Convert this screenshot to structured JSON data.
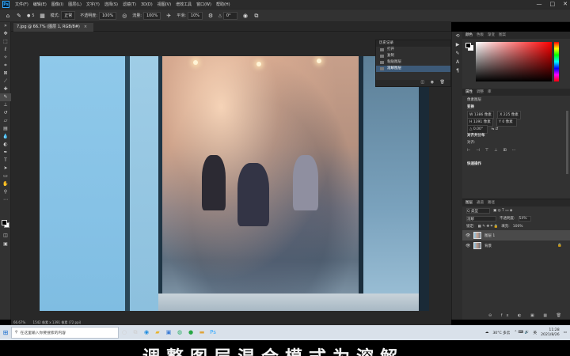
{
  "app": {
    "menu": [
      "文件(F)",
      "编辑(E)",
      "图像(I)",
      "图层(L)",
      "文字(Y)",
      "选择(S)",
      "滤镜(T)",
      "3D(D)",
      "视图(V)",
      "增效工具",
      "窗口(W)",
      "帮助(H)"
    ],
    "window_controls": [
      "—",
      "□",
      "✕"
    ]
  },
  "options": {
    "brush_size": "5",
    "mode_label": "模式:",
    "mode_value": "正常",
    "opacity_label": "不透明度:",
    "opacity_value": "100%",
    "flow_label": "流量:",
    "flow_value": "100%",
    "smooth_label": "平滑:",
    "smooth_value": "10%",
    "angle_value": "0°"
  },
  "document": {
    "tab_title": "7.jpg @ 66.7% (图层 1, RGB/8#)",
    "close_icon": "×"
  },
  "history": {
    "title": "历史记录",
    "items": [
      "打开",
      "复制",
      "粘贴图层",
      "溶解图层"
    ],
    "selected_index": 3,
    "footer_icons": "◫ ◉ 🗑"
  },
  "panels": {
    "color_tabs": [
      "颜色",
      "色板",
      "渐变",
      "图案"
    ],
    "props_tabs": [
      "属性",
      "调整",
      "库"
    ],
    "pixel_layer": "像素图层",
    "transform_title": "变换",
    "w": "W 1386 像素",
    "h": "H 1391 像素",
    "x": "X 225 像素",
    "y": "Y 0 像素",
    "angle": "△ 0.00°",
    "align_title": "对齐并分布",
    "align_label": "对齐:",
    "quick_actions": "快速操作"
  },
  "layers": {
    "tabs": [
      "图层",
      "通道",
      "路径"
    ],
    "kind": "Q 类型",
    "blend_mode": "溶解",
    "opacity_label": "不透明度:",
    "opacity_value": "54%",
    "lock_label": "锁定:",
    "fill_label": "填充:",
    "fill_value": "100%",
    "items": [
      {
        "name": "图层 1",
        "selected": true
      },
      {
        "name": "背景",
        "selected": false
      }
    ],
    "footer_icons": "⊖ fx ◐ ▣ ▦ 🗑"
  },
  "status": {
    "zoom": "66.67%",
    "size": "1542 像素 x 1391 像素 (72 ppi)"
  },
  "taskbar": {
    "search_placeholder": "在这里输入你要搜索的内容",
    "weather": "30°C 多云",
    "lang": "英",
    "time": "11:28",
    "date": "2021/8/26"
  },
  "subtitle": "调整图层混合模式为溶解",
  "colors": {
    "ps_blue": "#31a8ff",
    "selection": "#3d5a78",
    "panel_bg": "#323232"
  }
}
